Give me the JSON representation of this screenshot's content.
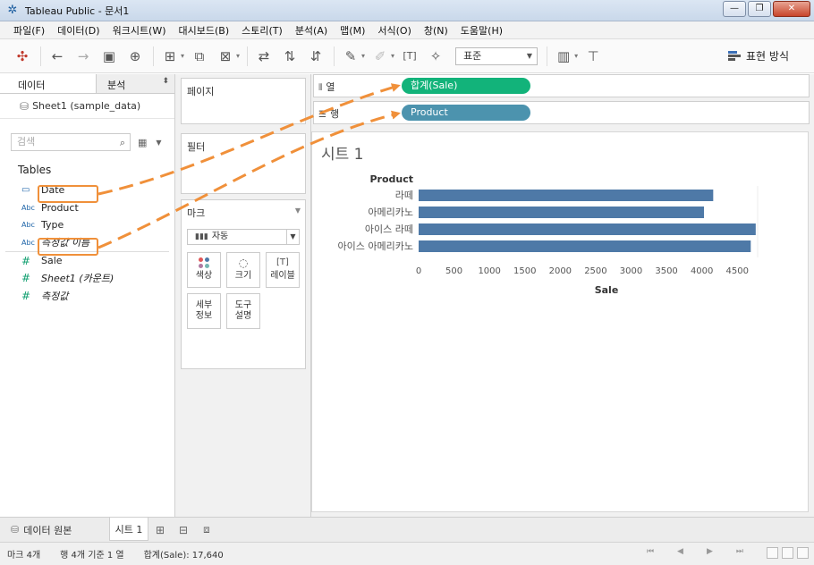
{
  "window": {
    "title": "Tableau Public - 문서1",
    "minimize": "—",
    "restore": "❐",
    "close": "✕"
  },
  "menu": [
    "파일(F)",
    "데이터(D)",
    "워크시트(W)",
    "대시보드(B)",
    "스토리(T)",
    "분석(A)",
    "맵(M)",
    "서식(O)",
    "창(N)",
    "도움말(H)"
  ],
  "toolbar": {
    "fit_select": "표준",
    "show_me": "표현 방식",
    "icons": [
      "tableau-logo-icon",
      "undo-icon",
      "redo-icon",
      "save-icon",
      "new-datasource-icon",
      "new-worksheet-icon",
      "duplicate-icon",
      "clear-icon",
      "swap-icon",
      "sort-asc-icon",
      "sort-desc-icon",
      "highlight-icon",
      "group-icon",
      "label-icon",
      "pin-icon",
      "show-cards-icon",
      "presentation-icon"
    ]
  },
  "data_pane": {
    "tab_data": "데이터",
    "tab_analysis": "분석",
    "datasource": "Sheet1 (sample_data)",
    "search_placeholder": "검색",
    "section": "Tables",
    "dimensions": [
      {
        "type": "date",
        "type_label": "▭",
        "name": "Date"
      },
      {
        "type": "abc",
        "type_label": "Abc",
        "name": "Product"
      },
      {
        "type": "abc",
        "type_label": "Abc",
        "name": "Type"
      },
      {
        "type": "abc",
        "type_label": "Abc",
        "name": "측정값 이름"
      }
    ],
    "measures": [
      {
        "type_label": "#",
        "name": "Sale"
      },
      {
        "type_label": "#",
        "name": "Sheet1 (카운트)"
      },
      {
        "type_label": "#",
        "name": "측정값"
      }
    ]
  },
  "cards": {
    "pages": "페이지",
    "filters": "필터",
    "marks": "마크",
    "mark_type": "자동",
    "buttons": {
      "color": "색상",
      "size": "크기",
      "label": "레이블",
      "detail_1": "세부",
      "detail_2": "정보",
      "tooltip_1": "도구",
      "tooltip_2": "설명"
    }
  },
  "shelves": {
    "columns_label": "열",
    "rows_label": "행",
    "columns_pill": "합계(Sale)",
    "rows_pill": "Product",
    "columns_color": "#12b37a",
    "rows_color": "#4c93ae"
  },
  "sheet_title": "시트 1",
  "chart_data": {
    "type": "bar",
    "orientation": "horizontal",
    "row_header": "Product",
    "categories": [
      "라떼",
      "아메리카노",
      "아이스 라떼",
      "아이스 아메리카노"
    ],
    "values": [
      4160,
      4030,
      4760,
      4690
    ],
    "xlabel": "Sale",
    "xlim": [
      0,
      4800
    ],
    "xticks": [
      0,
      500,
      1000,
      1500,
      2000,
      2500,
      3000,
      3500,
      4000,
      4500
    ],
    "bar_color": "#4e79a7"
  },
  "bottom_tabs": {
    "datasource": "데이터 원본",
    "sheet": "시트 1"
  },
  "status": {
    "marks": "마크 4개",
    "rows_cols": "행 4개 기준 1 열",
    "sum": "합계(Sale): 17,640"
  },
  "colors": {
    "annotation": "#f0903a"
  }
}
